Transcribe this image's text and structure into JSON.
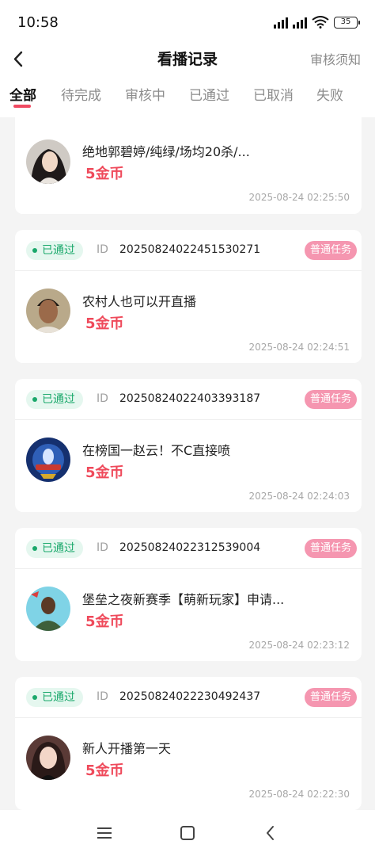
{
  "status_bar": {
    "time": "10:58",
    "battery": "35"
  },
  "header": {
    "title": "看播记录",
    "right_link": "审核须知"
  },
  "tabs": [
    {
      "label": "全部",
      "active": true
    },
    {
      "label": "待完成"
    },
    {
      "label": "审核中"
    },
    {
      "label": "已通过"
    },
    {
      "label": "已取消"
    },
    {
      "label": "失败"
    }
  ],
  "records": [
    {
      "room_name": "绝地郭碧婷/纯绿/场均20杀/...",
      "reward": "5金币",
      "time": "2025-08-24 02:25:50"
    },
    {
      "status": "已通过",
      "id_label": "ID",
      "id": "20250824022451530271",
      "tag": "普通任务",
      "room_name": "农村人也可以开直播",
      "reward": "5金币",
      "time": "2025-08-24 02:24:51"
    },
    {
      "status": "已通过",
      "id_label": "ID",
      "id": "20250824022403393187",
      "tag": "普通任务",
      "room_name": "在榜国一赵云！不C直接喷",
      "reward": "5金币",
      "time": "2025-08-24 02:24:03"
    },
    {
      "status": "已通过",
      "id_label": "ID",
      "id": "20250824022312539004",
      "tag": "普通任务",
      "room_name": "堡垒之夜新赛季【萌新玩家】申请...",
      "reward": "5金币",
      "time": "2025-08-24 02:23:12"
    },
    {
      "status": "已通过",
      "id_label": "ID",
      "id": "20250824022230492437",
      "tag": "普通任务",
      "room_name": "新人开播第一天",
      "reward": "5金币",
      "time": "2025-08-24 02:22:30"
    }
  ],
  "colors": {
    "accent": "#f04a62",
    "reward": "#ef4a5b",
    "passed": "#1aa86b",
    "tag": "#f596b0"
  },
  "icons": [
    "back-arrow-icon",
    "menu-icon",
    "home-square-icon",
    "back-triangle-icon",
    "wifi-icon",
    "signal-icon",
    "battery-icon"
  ]
}
